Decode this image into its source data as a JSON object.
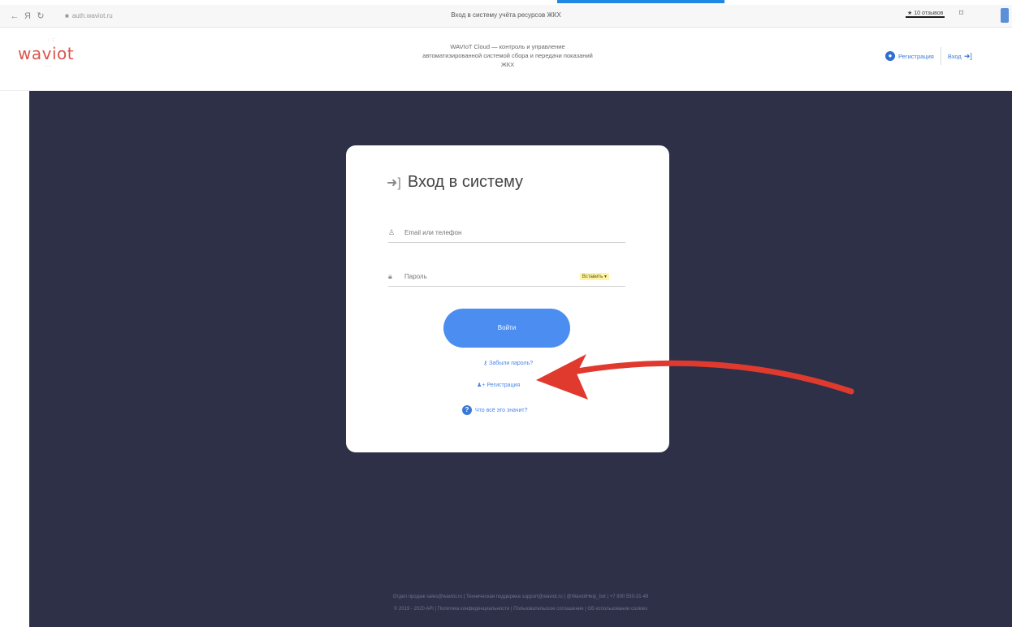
{
  "browser": {
    "url": "auth.waviot.ru",
    "tab_title": "Вход в систему учёта ресурсов ЖКХ",
    "reviews": "★ 10 отзывов"
  },
  "header": {
    "logo": "waviot",
    "description_line1": "WAVIoT Cloud — контроль и управление",
    "description_line2": "автоматизированной системой сбора и передачи показаний",
    "description_line3": "ЖКХ",
    "register_label": "Регистрация",
    "login_label": "Вход"
  },
  "card": {
    "title": "Вход в систему",
    "email_placeholder": "Email или телефон",
    "password_placeholder": "Пароль",
    "paste_label": "Вставить",
    "submit_label": "Войти",
    "forgot_label": "Забыли пароль?",
    "register_label": "Регистрация",
    "what_label": "Что всё это значит?"
  },
  "footer": {
    "line1": "Отдел продаж  sales@waviot.ru  |  Техническая поддержка  support@waviot.ru  |  @WaviotHelp_bot  |  +7 800 550-31-49",
    "line2": "© 2019 - 2020  API  |  Политика конфиденциальности  |  Пользовательское соглашение  |  Об использовании cookies"
  },
  "colors": {
    "accent": "#4b8df0",
    "background_dark": "#2e3048",
    "logo": "#d9554c",
    "annotation_arrow": "#e03a2e"
  }
}
